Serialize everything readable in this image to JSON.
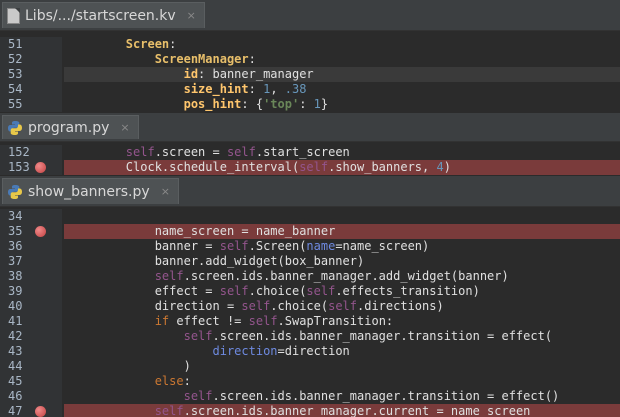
{
  "panes": [
    {
      "tab": {
        "title": "Libs/.../startscreen.kv",
        "close": "×",
        "icon": "kv-file-icon"
      },
      "lines": [
        {
          "n": "51",
          "bp": false,
          "hl": "",
          "t": [
            {
              "s": "        ",
              "c": "k-pln"
            },
            {
              "s": "Screen",
              "c": "k-name"
            },
            {
              "s": ":",
              "c": "k-pln"
            }
          ]
        },
        {
          "n": "52",
          "bp": false,
          "hl": "",
          "t": [
            {
              "s": "            ",
              "c": "k-pln"
            },
            {
              "s": "ScreenManager",
              "c": "k-name"
            },
            {
              "s": ":",
              "c": "k-pln"
            }
          ]
        },
        {
          "n": "53",
          "bp": false,
          "hl": "caret",
          "t": [
            {
              "s": "                ",
              "c": "k-pln"
            },
            {
              "s": "id",
              "c": "k-attr"
            },
            {
              "s": ": banner_manager",
              "c": "k-pln"
            }
          ]
        },
        {
          "n": "54",
          "bp": false,
          "hl": "",
          "t": [
            {
              "s": "                ",
              "c": "k-pln"
            },
            {
              "s": "size_hint",
              "c": "k-attr"
            },
            {
              "s": ": ",
              "c": "k-pln"
            },
            {
              "s": "1",
              "c": "k-num"
            },
            {
              "s": ", ",
              "c": "k-pln"
            },
            {
              "s": ".38",
              "c": "k-num"
            }
          ]
        },
        {
          "n": "55",
          "bp": false,
          "hl": "",
          "t": [
            {
              "s": "                ",
              "c": "k-pln"
            },
            {
              "s": "pos_hint",
              "c": "k-attr"
            },
            {
              "s": ": {",
              "c": "k-pln"
            },
            {
              "s": "'top'",
              "c": "k-str"
            },
            {
              "s": ": ",
              "c": "k-pln"
            },
            {
              "s": "1",
              "c": "k-num"
            },
            {
              "s": "}",
              "c": "k-pln"
            }
          ]
        }
      ]
    },
    {
      "tab": {
        "title": "program.py",
        "close": "×",
        "icon": "python-file-icon"
      },
      "lines": [
        {
          "n": "152",
          "bp": false,
          "hl": "",
          "t": [
            {
              "s": "        ",
              "c": "k-pln"
            },
            {
              "s": "self",
              "c": "k-self"
            },
            {
              "s": ".screen = ",
              "c": "k-pln"
            },
            {
              "s": "self",
              "c": "k-self"
            },
            {
              "s": ".start_screen",
              "c": "k-pln"
            }
          ]
        },
        {
          "n": "153",
          "bp": true,
          "hl": "bp",
          "t": [
            {
              "s": "        Clock.schedule_interval(",
              "c": "k-pln"
            },
            {
              "s": "self",
              "c": "k-self"
            },
            {
              "s": ".show_banners, ",
              "c": "k-pln"
            },
            {
              "s": "4",
              "c": "k-num"
            },
            {
              "s": ")",
              "c": "k-pln"
            }
          ]
        }
      ]
    },
    {
      "tab": {
        "title": "show_banners.py",
        "close": "×",
        "icon": "python-file-icon"
      },
      "lines": [
        {
          "n": "34",
          "bp": false,
          "hl": "",
          "t": []
        },
        {
          "n": "35",
          "bp": true,
          "hl": "bp",
          "t": [
            {
              "s": "            name_screen = name_banner",
              "c": "k-pln"
            }
          ]
        },
        {
          "n": "36",
          "bp": false,
          "hl": "",
          "t": [
            {
              "s": "            banner = ",
              "c": "k-pln"
            },
            {
              "s": "self",
              "c": "k-self"
            },
            {
              "s": ".Screen(",
              "c": "k-pln"
            },
            {
              "s": "name",
              "c": "k-pname"
            },
            {
              "s": "=name_screen)",
              "c": "k-pln"
            }
          ]
        },
        {
          "n": "37",
          "bp": false,
          "hl": "",
          "t": [
            {
              "s": "            banner.add_widget(box_banner)",
              "c": "k-pln"
            }
          ]
        },
        {
          "n": "38",
          "bp": false,
          "hl": "",
          "t": [
            {
              "s": "            ",
              "c": "k-pln"
            },
            {
              "s": "self",
              "c": "k-self"
            },
            {
              "s": ".screen.ids.banner_manager.add_widget(banner)",
              "c": "k-pln"
            }
          ]
        },
        {
          "n": "39",
          "bp": false,
          "hl": "",
          "t": [
            {
              "s": "            effect = ",
              "c": "k-pln"
            },
            {
              "s": "self",
              "c": "k-self"
            },
            {
              "s": ".choice(",
              "c": "k-pln"
            },
            {
              "s": "self",
              "c": "k-self"
            },
            {
              "s": ".effects_transition)",
              "c": "k-pln"
            }
          ]
        },
        {
          "n": "40",
          "bp": false,
          "hl": "",
          "t": [
            {
              "s": "            direction = ",
              "c": "k-pln"
            },
            {
              "s": "self",
              "c": "k-self"
            },
            {
              "s": ".choice(",
              "c": "k-pln"
            },
            {
              "s": "self",
              "c": "k-self"
            },
            {
              "s": ".directions)",
              "c": "k-pln"
            }
          ]
        },
        {
          "n": "41",
          "bp": false,
          "hl": "",
          "t": [
            {
              "s": "            ",
              "c": "k-pln"
            },
            {
              "s": "if",
              "c": "k-kw"
            },
            {
              "s": " effect != ",
              "c": "k-pln"
            },
            {
              "s": "self",
              "c": "k-self"
            },
            {
              "s": ".SwapTransition:",
              "c": "k-pln"
            }
          ]
        },
        {
          "n": "42",
          "bp": false,
          "hl": "",
          "t": [
            {
              "s": "                ",
              "c": "k-pln"
            },
            {
              "s": "self",
              "c": "k-self"
            },
            {
              "s": ".screen.ids.banner_manager.transition = effect(",
              "c": "k-pln"
            }
          ]
        },
        {
          "n": "43",
          "bp": false,
          "hl": "",
          "t": [
            {
              "s": "                    ",
              "c": "k-pln"
            },
            {
              "s": "direction",
              "c": "k-pname"
            },
            {
              "s": "=direction",
              "c": "k-pln"
            }
          ]
        },
        {
          "n": "44",
          "bp": false,
          "hl": "",
          "t": [
            {
              "s": "                )",
              "c": "k-pln"
            }
          ]
        },
        {
          "n": "45",
          "bp": false,
          "hl": "",
          "t": [
            {
              "s": "            ",
              "c": "k-pln"
            },
            {
              "s": "else",
              "c": "k-kw"
            },
            {
              "s": ":",
              "c": "k-pln"
            }
          ]
        },
        {
          "n": "46",
          "bp": false,
          "hl": "",
          "t": [
            {
              "s": "                ",
              "c": "k-pln"
            },
            {
              "s": "self",
              "c": "k-self"
            },
            {
              "s": ".screen.ids.banner_manager.transition = effect()",
              "c": "k-pln"
            }
          ]
        },
        {
          "n": "47",
          "bp": true,
          "hl": "bp",
          "t": [
            {
              "s": "            ",
              "c": "k-pln"
            },
            {
              "s": "self",
              "c": "k-self"
            },
            {
              "s": ".screen.ids.banner_manager.current = name_screen",
              "c": "k-pln"
            }
          ]
        }
      ]
    }
  ]
}
